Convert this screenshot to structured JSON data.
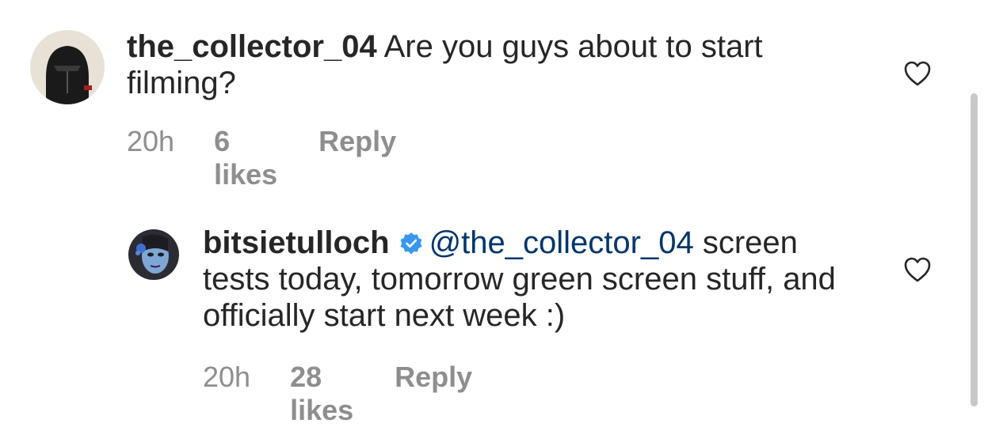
{
  "comments": [
    {
      "username": "the_collector_04",
      "text": "Are you guys about to start filming?",
      "time": "20h",
      "likes": "6 likes",
      "reply": "Reply",
      "avatar_icon": "helmet-avatar"
    },
    {
      "username": "bitsietulloch",
      "verified": true,
      "mention": "@the_collector_04",
      "text": "screen tests today, tomorrow green screen stuff, and officially start next week :)",
      "time": "20h",
      "likes": "28 likes",
      "reply": "Reply",
      "avatar_icon": "face-paint-avatar"
    }
  ],
  "icons": {
    "like": "heart-icon",
    "verified": "verified-badge-icon"
  },
  "colors": {
    "text": "#262626",
    "meta": "#8e8e8e",
    "mention": "#003569",
    "verified": "#3897f0"
  }
}
